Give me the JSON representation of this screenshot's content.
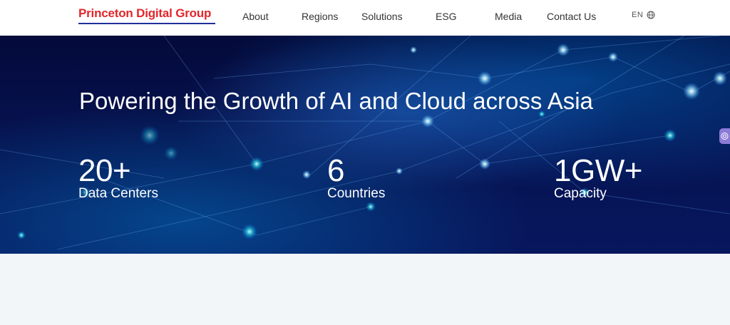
{
  "header": {
    "logo_text": "Princeton Digital Group",
    "nav": [
      {
        "label": "About"
      },
      {
        "label": "Regions"
      },
      {
        "label": "Solutions"
      },
      {
        "label": "ESG"
      },
      {
        "label": "Media"
      },
      {
        "label": "Contact Us"
      }
    ],
    "language": {
      "label": "EN",
      "icon": "globe-icon"
    }
  },
  "hero": {
    "title": "Powering the Growth of AI and Cloud across Asia",
    "stats": [
      {
        "value": "20+",
        "label": "Data Centers"
      },
      {
        "value": "6",
        "label": "Countries"
      },
      {
        "value": "1GW+",
        "label": "Capacity"
      }
    ]
  },
  "side_widget": {
    "icon": "accessibility-icon",
    "color": "#8c7ad8"
  },
  "colors": {
    "brand_red": "#e3262b",
    "brand_blue": "#1f2f9b",
    "hero_bg": "#06124f",
    "page_bg": "#f3f6f9"
  }
}
